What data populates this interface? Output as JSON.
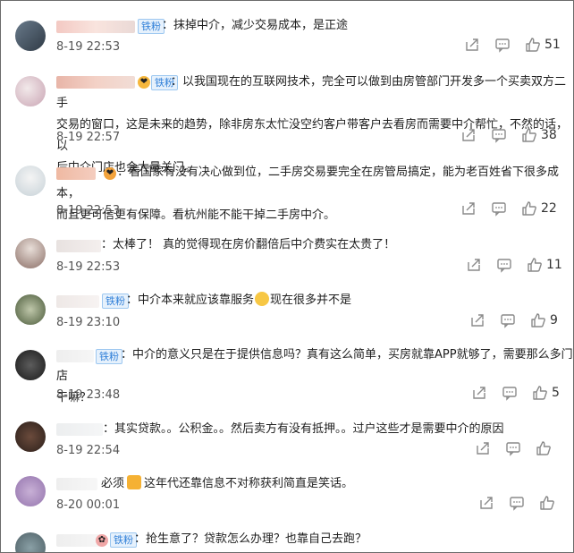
{
  "badge_label": "铁粉",
  "comments": [
    {
      "separator": "：",
      "text": "抹掉中介，减少交易成本，是正途",
      "time": "8-19 22:53",
      "likes": "51",
      "badge": true
    },
    {
      "separator": "：",
      "text": "以我国现在的互联网技术，完全可以做到由房管部门开发多一个买卖双方二手\n交易的窗口，这是未来的趋势，除非房东太忙没空约客户带客户去看房而需要中介帮忙，不然的话，以\n后中介门店也会大量关门。",
      "time": "8-19 22:57",
      "likes": "38",
      "badge": true
    },
    {
      "separator": "：",
      "text": "看国家有没有决心做到位，二手房交易要完全在房管局搞定，能为老百姓省下很多成本，\n而且更可信更有保障。看杭州能不能干掉二手房中介。",
      "time": "8-19 22:53",
      "likes": "22",
      "badge": false
    },
    {
      "separator": "：",
      "text": "太棒了！ 真的觉得现在房价翻倍后中介费实在太贵了！",
      "time": "8-19 22:53",
      "likes": "11",
      "badge": false
    },
    {
      "separator": "：",
      "text": "中介本来就应该靠服务",
      "text_after": "现在很多并不是",
      "time": "8-19 23:10",
      "likes": "9",
      "badge": true
    },
    {
      "separator": "：",
      "text": "中介的意义只是在于提供信息吗？真有这么简单，买房就靠APP就够了，需要那么多门店\n干嘛？",
      "time": "8-19 23:48",
      "likes": "5",
      "badge": true
    },
    {
      "separator": "：",
      "text": "其实贷款。。公积金。。然后卖方有没有抵押。。过户这些才是需要中介的原因",
      "time": "8-19 22:54",
      "likes": "",
      "badge": false
    },
    {
      "separator": "：",
      "text": "必须",
      "text_after": "这年代还靠信息不对称获利简直是笑话。",
      "time": "8-20 00:01",
      "likes": "",
      "badge": false
    },
    {
      "separator": "：",
      "text": "抢生意了？贷款怎么办理？也靠自己去跑？",
      "time": "",
      "likes": "",
      "badge": true
    }
  ],
  "colors": {
    "accent": "#2f7fd8",
    "badge_bg": "#e6f1fc",
    "icon": "#8a8a8a",
    "text": "#1e1e1e",
    "time": "#555555"
  },
  "icons": [
    "share-icon",
    "comment-icon",
    "like-icon"
  ]
}
